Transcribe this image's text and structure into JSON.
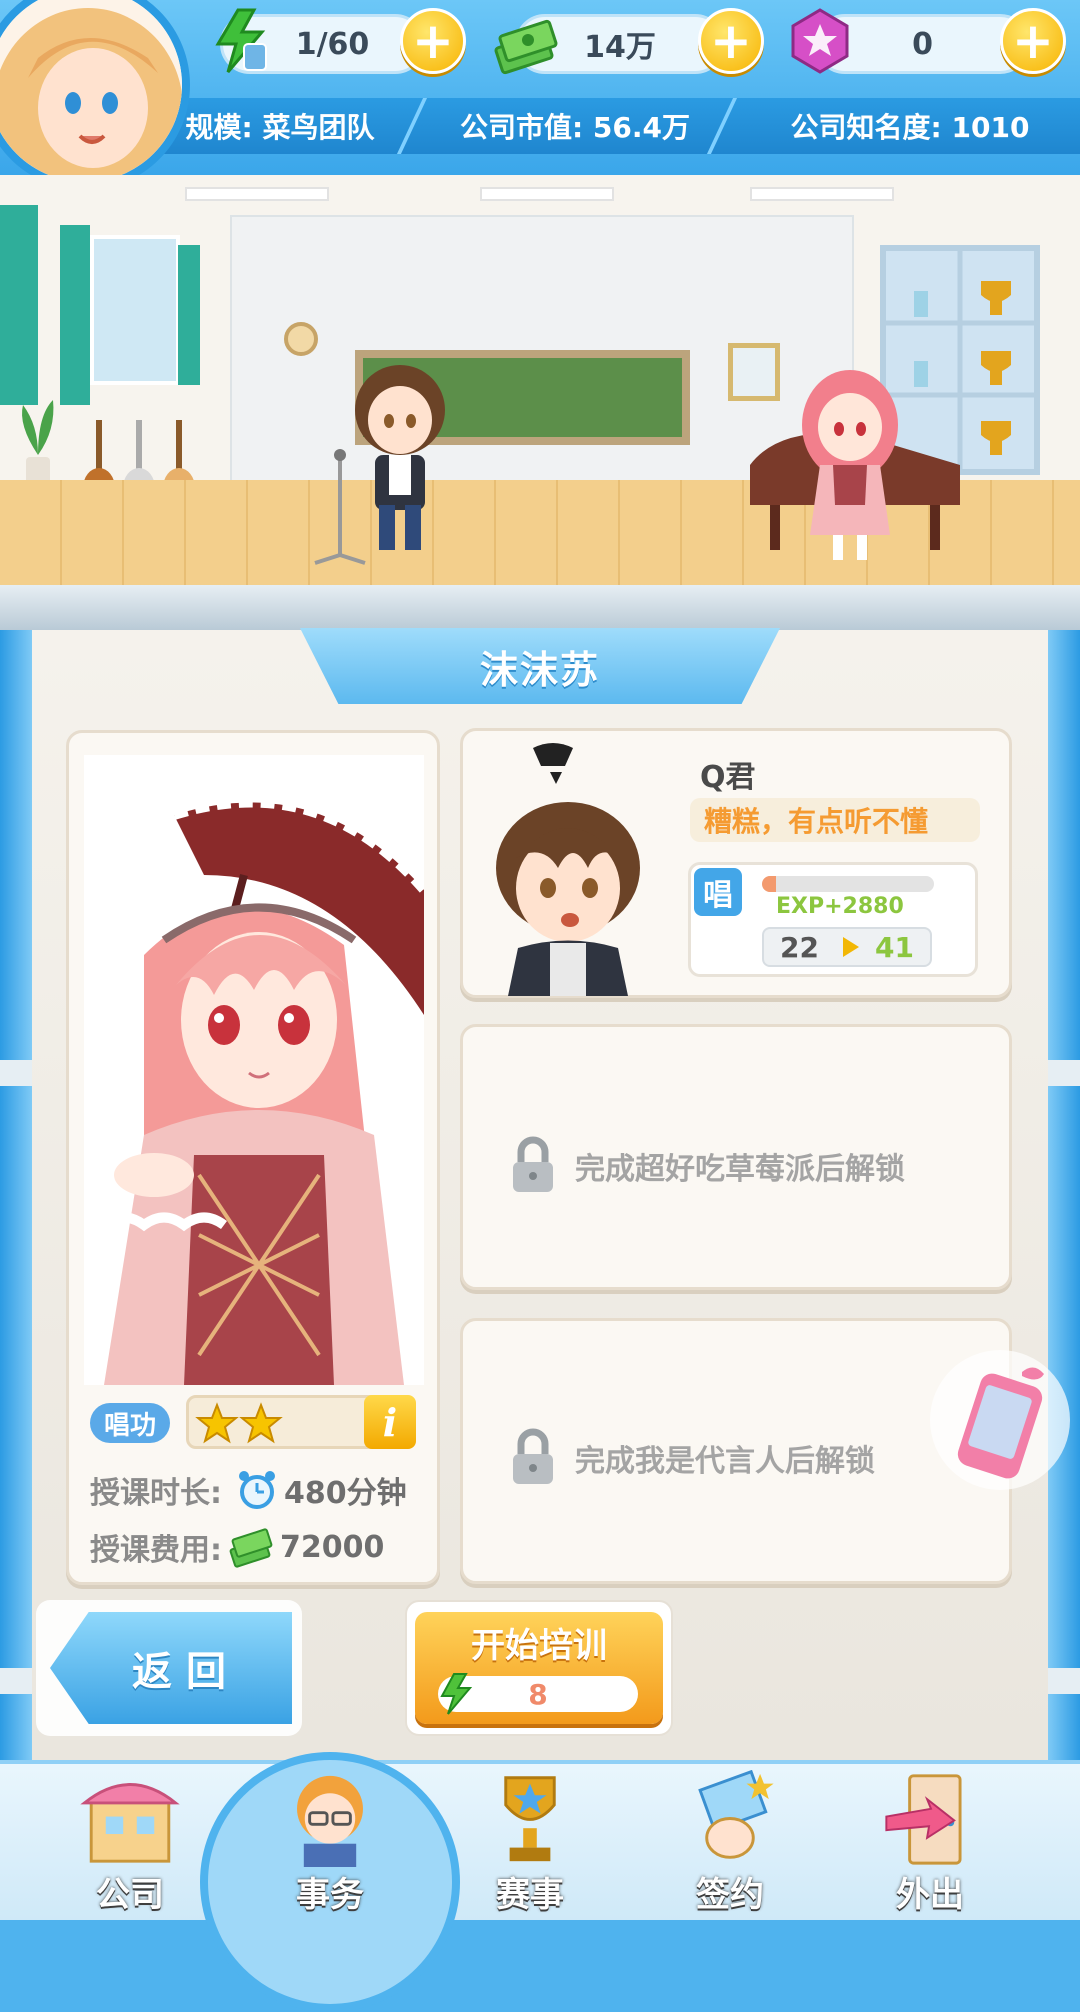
{
  "topbar": {
    "energy": "1/60",
    "money": "14万",
    "gems": "0",
    "plus_symbol": "+",
    "scale_label": "规模: 菜鸟团队",
    "market_value_label": "公司市值: 56.4万",
    "fame_label": "公司知名度: 1010"
  },
  "panel": {
    "title": "沫沫苏",
    "skill_badge": "唱功",
    "star_count": 2,
    "info_symbol": "i",
    "duration_label": "授课时长:",
    "duration_value": "480分钟",
    "fee_label": "授课费用:",
    "fee_value": "72000"
  },
  "teacher": {
    "name": "Q君",
    "mood": "糟糕，有点听不懂",
    "skill_tag": "唱",
    "exp_text": "EXP+2880",
    "exp_fraction": 0.08,
    "level_from": "22",
    "level_to": "41"
  },
  "locked": [
    {
      "text": "完成超好吃草莓派后解锁"
    },
    {
      "text": "完成我是代言人后解锁"
    }
  ],
  "buttons": {
    "back": "返回",
    "train": "开始培训",
    "train_cost": "8"
  },
  "nav": [
    {
      "label": "公司"
    },
    {
      "label": "事务"
    },
    {
      "label": "赛事"
    },
    {
      "label": "签约"
    },
    {
      "label": "外出"
    }
  ],
  "colors": {
    "accent_blue": "#3aa6ea",
    "orange": "#f39a1b",
    "mood_orange": "#f59b32",
    "exp_green": "#8cc63f"
  }
}
